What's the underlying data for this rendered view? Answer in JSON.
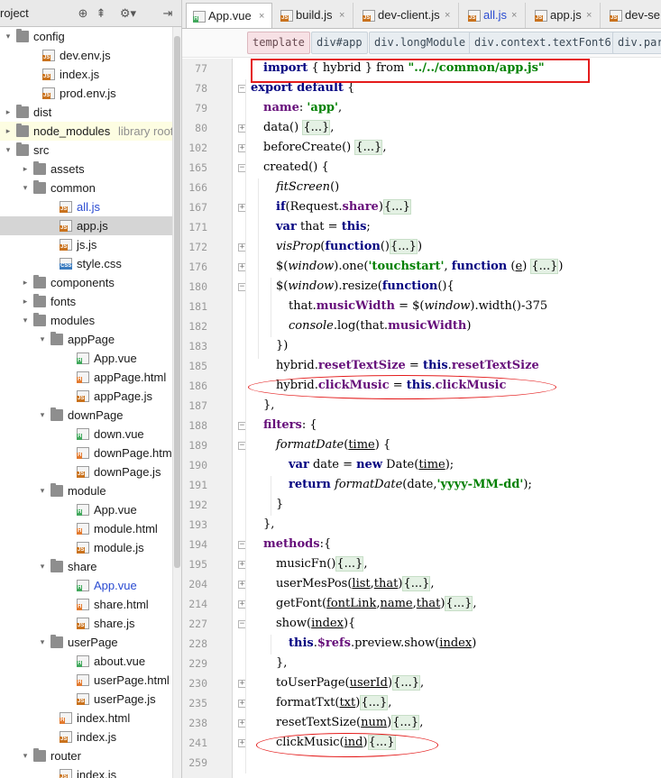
{
  "sidebar": {
    "title": "roject",
    "header_icons": [
      "globe-icon",
      "collapse-all-icon",
      "gear-icon",
      "hide-icon"
    ],
    "tree": [
      {
        "label": "config",
        "type": "folder",
        "depth": 0,
        "expanded": true
      },
      {
        "label": "dev.env.js",
        "type": "js",
        "depth": 1
      },
      {
        "label": "index.js",
        "type": "js",
        "depth": 1
      },
      {
        "label": "prod.env.js",
        "type": "js",
        "depth": 1
      },
      {
        "label": "dist",
        "type": "folder",
        "depth": 0,
        "expanded": false
      },
      {
        "label": "node_modules",
        "type": "folder",
        "depth": 0,
        "expanded": false,
        "note": "library root"
      },
      {
        "label": "src",
        "type": "folder",
        "depth": 0,
        "expanded": true
      },
      {
        "label": "assets",
        "type": "folder",
        "depth": 1,
        "expanded": false
      },
      {
        "label": "common",
        "type": "folder",
        "depth": 1,
        "expanded": true
      },
      {
        "label": "all.js",
        "type": "js",
        "depth": 2,
        "color": "blue"
      },
      {
        "label": "app.js",
        "type": "js",
        "depth": 2,
        "selected": true
      },
      {
        "label": "js.js",
        "type": "js",
        "depth": 2
      },
      {
        "label": "style.css",
        "type": "css",
        "depth": 2
      },
      {
        "label": "components",
        "type": "folder",
        "depth": 1,
        "expanded": false
      },
      {
        "label": "fonts",
        "type": "folder",
        "depth": 1,
        "expanded": false
      },
      {
        "label": "modules",
        "type": "folder",
        "depth": 1,
        "expanded": true
      },
      {
        "label": "appPage",
        "type": "folder",
        "depth": 2,
        "expanded": true
      },
      {
        "label": "App.vue",
        "type": "vue",
        "depth": 3
      },
      {
        "label": "appPage.html",
        "type": "html",
        "depth": 3
      },
      {
        "label": "appPage.js",
        "type": "js",
        "depth": 3
      },
      {
        "label": "downPage",
        "type": "folder",
        "depth": 2,
        "expanded": true
      },
      {
        "label": "down.vue",
        "type": "vue",
        "depth": 3
      },
      {
        "label": "downPage.html",
        "type": "html",
        "depth": 3
      },
      {
        "label": "downPage.js",
        "type": "js",
        "depth": 3
      },
      {
        "label": "module",
        "type": "folder",
        "depth": 2,
        "expanded": true
      },
      {
        "label": "App.vue",
        "type": "vue",
        "depth": 3
      },
      {
        "label": "module.html",
        "type": "html",
        "depth": 3
      },
      {
        "label": "module.js",
        "type": "js",
        "depth": 3
      },
      {
        "label": "share",
        "type": "folder",
        "depth": 2,
        "expanded": true
      },
      {
        "label": "App.vue",
        "type": "vue",
        "depth": 3,
        "color": "blue"
      },
      {
        "label": "share.html",
        "type": "html",
        "depth": 3
      },
      {
        "label": "share.js",
        "type": "js",
        "depth": 3
      },
      {
        "label": "userPage",
        "type": "folder",
        "depth": 2,
        "expanded": true
      },
      {
        "label": "about.vue",
        "type": "vue",
        "depth": 3
      },
      {
        "label": "userPage.html",
        "type": "html",
        "depth": 3
      },
      {
        "label": "userPage.js",
        "type": "js",
        "depth": 3
      },
      {
        "label": "index.html",
        "type": "html",
        "depth": 2
      },
      {
        "label": "index.js",
        "type": "js",
        "depth": 2
      },
      {
        "label": "router",
        "type": "folder",
        "depth": 1,
        "expanded": true
      },
      {
        "label": "index.js",
        "type": "js",
        "depth": 2
      }
    ]
  },
  "tabs": [
    {
      "label": "App.vue",
      "type": "vue",
      "active": true
    },
    {
      "label": "build.js",
      "type": "js"
    },
    {
      "label": "dev-client.js",
      "type": "js"
    },
    {
      "label": "all.js",
      "type": "js",
      "color": "blue"
    },
    {
      "label": "app.js",
      "type": "js"
    },
    {
      "label": "dev-se",
      "type": "js"
    }
  ],
  "breadcrumbs": [
    "template",
    "div#app",
    "div.longModule",
    "div.context.textFont6",
    "div.par"
  ],
  "editor": {
    "lines": [
      {
        "no": "77",
        "indent": 1,
        "text": "import { hybrid } from \"../../common/app.js\"",
        "style": "import"
      },
      {
        "no": "78",
        "indent": 0,
        "text": "export default {",
        "style": "kwline"
      },
      {
        "no": "79",
        "indent": 1,
        "text": "name: 'app',",
        "style": "name"
      },
      {
        "no": "80",
        "indent": 1,
        "text": "data() {...},",
        "style": "plain"
      },
      {
        "no": "102",
        "indent": 1,
        "text": "beforeCreate() {...},",
        "style": "plain"
      },
      {
        "no": "165",
        "indent": 1,
        "text": "created() {",
        "style": "plain"
      },
      {
        "no": "166",
        "indent": 2,
        "text": "fitScreen()",
        "style": "italic"
      },
      {
        "no": "167",
        "indent": 2,
        "text": "if(Request.share){...}",
        "style": "plain"
      },
      {
        "no": "171",
        "indent": 2,
        "text": "var that = this;",
        "style": "plain"
      },
      {
        "no": "172",
        "indent": 2,
        "text": "visProp(function(){...})",
        "style": "plain"
      },
      {
        "no": "176",
        "indent": 2,
        "text": "$(window).one('touchstart', function (e) {...})",
        "style": "plain"
      },
      {
        "no": "180",
        "indent": 2,
        "text": "$(window).resize(function(){",
        "style": "plain"
      },
      {
        "no": "181",
        "indent": 3,
        "text": "that.musicWidth = $(window).width()-375",
        "style": "plain"
      },
      {
        "no": "182",
        "indent": 3,
        "text": "console.log(that.musicWidth)",
        "style": "plain"
      },
      {
        "no": "183",
        "indent": 2,
        "text": "})",
        "style": "plain"
      },
      {
        "no": "185",
        "indent": 2,
        "text": "hybrid.resetTextSize = this.resetTextSize",
        "style": "plain"
      },
      {
        "no": "186",
        "indent": 2,
        "text": "hybrid.clickMusic = this.clickMusic",
        "style": "plain"
      },
      {
        "no": "187",
        "indent": 1,
        "text": "},",
        "style": "plain"
      },
      {
        "no": "188",
        "indent": 1,
        "text": "filters: {",
        "style": "plain"
      },
      {
        "no": "189",
        "indent": 2,
        "text": "formatDate(time) {",
        "style": "plain"
      },
      {
        "no": "190",
        "indent": 3,
        "text": "var date = new Date(time);",
        "style": "plain"
      },
      {
        "no": "191",
        "indent": 3,
        "text": "return formatDate(date,'yyyy-MM-dd');",
        "style": "plain"
      },
      {
        "no": "192",
        "indent": 2,
        "text": "}",
        "style": "plain"
      },
      {
        "no": "193",
        "indent": 1,
        "text": "},",
        "style": "plain"
      },
      {
        "no": "194",
        "indent": 1,
        "text": "methods:{",
        "style": "plain"
      },
      {
        "no": "195",
        "indent": 2,
        "text": "musicFn(){...},",
        "style": "plain"
      },
      {
        "no": "204",
        "indent": 2,
        "text": "userMesPos(list,that){...},",
        "style": "plain"
      },
      {
        "no": "214",
        "indent": 2,
        "text": "getFont(fontLink,name,that){...},",
        "style": "plain"
      },
      {
        "no": "227",
        "indent": 2,
        "text": "show(index){",
        "style": "plain"
      },
      {
        "no": "228",
        "indent": 3,
        "text": "this.$refs.preview.show(index)",
        "style": "plain"
      },
      {
        "no": "229",
        "indent": 2,
        "text": "},",
        "style": "plain"
      },
      {
        "no": "230",
        "indent": 2,
        "text": "toUserPage(userId){...},",
        "style": "plain"
      },
      {
        "no": "235",
        "indent": 2,
        "text": "formatTxt(txt){...},",
        "style": "plain"
      },
      {
        "no": "238",
        "indent": 2,
        "text": "resetTextSize(num){...},",
        "style": "plain"
      },
      {
        "no": "241",
        "indent": 2,
        "text": "clickMusic(ind){...}",
        "style": "plain"
      },
      {
        "no": "259",
        "indent": 0,
        "text": "",
        "style": "plain"
      }
    ]
  },
  "annotations": {
    "color": "#e41b1b"
  }
}
